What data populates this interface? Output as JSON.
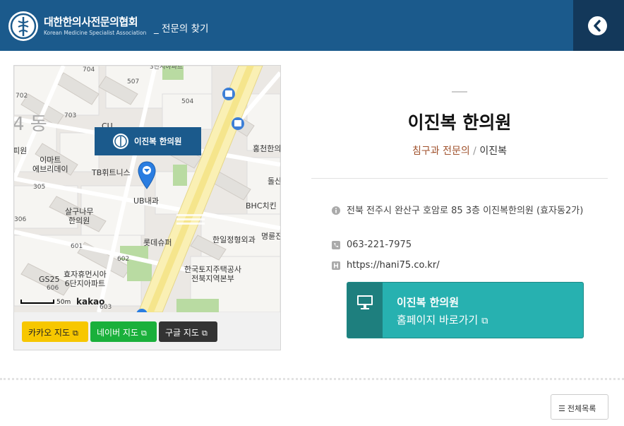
{
  "header": {
    "org_name_ko": "대한한의사전문의협회",
    "org_name_en": "Korean Medicine Specialist Association",
    "breadcrumb": "_ 전문의 찾기",
    "colors": {
      "bar": "#1b5a8c",
      "back_box": "#13385a"
    }
  },
  "map": {
    "popup_label": "이진복 한의원",
    "labels": {
      "l704": "704",
      "l507": "507",
      "l504": "504",
      "l702": "702",
      "l703": "703",
      "lCU": "CU",
      "ldong": "4 동",
      "lhospital": "피원",
      "lemart": "이마트\n에브리데이",
      "ltb": "TB휘트니스",
      "l305": "305",
      "lub": "UB내과",
      "lsal": "살구나무\n한의원",
      "l306": "306",
      "l601": "601",
      "llotte": "롯데슈퍼",
      "l602": "602",
      "lhyoja": "효자휴먼시아\n6단지아파트",
      "lgs": "GS25",
      "l606": "606",
      "l603": "603",
      "lhongcheon": "홍천한의",
      "ldol": "돌산",
      "lbhc": "BHC치킨",
      "lmyeong": "명륜진",
      "lhanil": "한일정형외과",
      "llh": "한국토지주택공사\n전북지역본부",
      "l3dan": "3단지아파트"
    },
    "scale_label": "50m",
    "brand": "kakao",
    "buttons": {
      "kakao": "카카오 지도",
      "naver": "네이버 지도",
      "google": "구글 지도"
    }
  },
  "clinic": {
    "name": "이진복 한의원",
    "specialty": "침구과 전문의",
    "doctor": "이진복",
    "address": "전북 전주시 완산구 호암로 85 3층 이진복한의원 (효자동2가)",
    "phone": "063-221-7975",
    "website": "https://hani75.co.kr/",
    "homepage_name": "이진복 한의원",
    "homepage_link": "홈페이지 바로가기"
  },
  "footer": {
    "list_button": "전체목록"
  },
  "icons": {
    "back": "chevron-left-icon",
    "info": "info-icon",
    "phone": "phone-icon",
    "web": "h-icon",
    "monitor": "monitor-icon",
    "external": "external-link-icon",
    "list": "list-icon"
  }
}
